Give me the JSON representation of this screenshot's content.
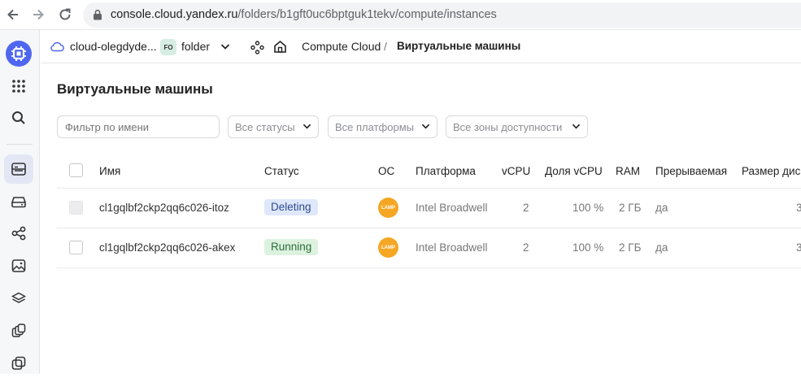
{
  "browser": {
    "url_host": "console.cloud.yandex.ru",
    "url_path": "/folders/b1gft0uc6bptguk1tekv/compute/instances"
  },
  "header": {
    "cloud_name": "cloud-olegdyde...",
    "folder_badge": "FO",
    "folder_name": "folder",
    "service": "Compute Cloud",
    "separator": "/",
    "section": "Виртуальные машины"
  },
  "page": {
    "title": "Виртуальные машины",
    "filter_placeholder": "Фильтр по имени",
    "status_select": "Все статусы",
    "platform_select": "Все платформы",
    "zone_select": "Все зоны доступности"
  },
  "table": {
    "columns": [
      "Имя",
      "Статус",
      "ОС",
      "Платформа",
      "vCPU",
      "Доля vCPU",
      "RAM",
      "Прерываемая",
      "Размер дис"
    ],
    "rows": [
      {
        "name": "cl1gqlbf2ckp2qq6c026-itoz",
        "status": "Deleting",
        "os": "LAMP",
        "platform": "Intel Broadwell",
        "vcpu": "2",
        "share": "100 %",
        "ram": "2 ГБ",
        "preemptible": "да",
        "disk": "3"
      },
      {
        "name": "cl1gqlbf2ckp2qq6c026-akex",
        "status": "Running",
        "os": "LAMP",
        "platform": "Intel Broadwell",
        "vcpu": "2",
        "share": "100 %",
        "ram": "2 ГБ",
        "preemptible": "да",
        "disk": "3"
      }
    ]
  },
  "colors": {
    "accent": "#4f67f0",
    "deleting_bg": "#dfe7fb",
    "running_bg": "#dcf2df",
    "os_logo": "#f5a623"
  }
}
